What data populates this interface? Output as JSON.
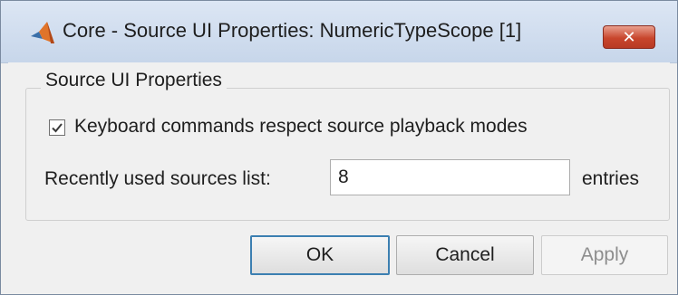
{
  "window": {
    "title": "Core - Source UI Properties: NumericTypeScope [1]",
    "close_label": "✕",
    "icon": "matlab-icon"
  },
  "group": {
    "title": "Source UI Properties"
  },
  "keyboard_option": {
    "label": "Keyboard commands respect source playback modes",
    "checked": true
  },
  "recent_sources": {
    "label": "Recently used sources list:",
    "value": "8",
    "suffix": "entries"
  },
  "buttons": {
    "ok": "OK",
    "cancel": "Cancel",
    "apply": "Apply",
    "apply_enabled": false
  },
  "colors": {
    "titlebar": "#c7d6ea",
    "close_button": "#c8462d",
    "window_background": "#f0f0f0",
    "ok_focus_border": "#3c7fb1",
    "disabled_text": "#8d8d8d"
  }
}
